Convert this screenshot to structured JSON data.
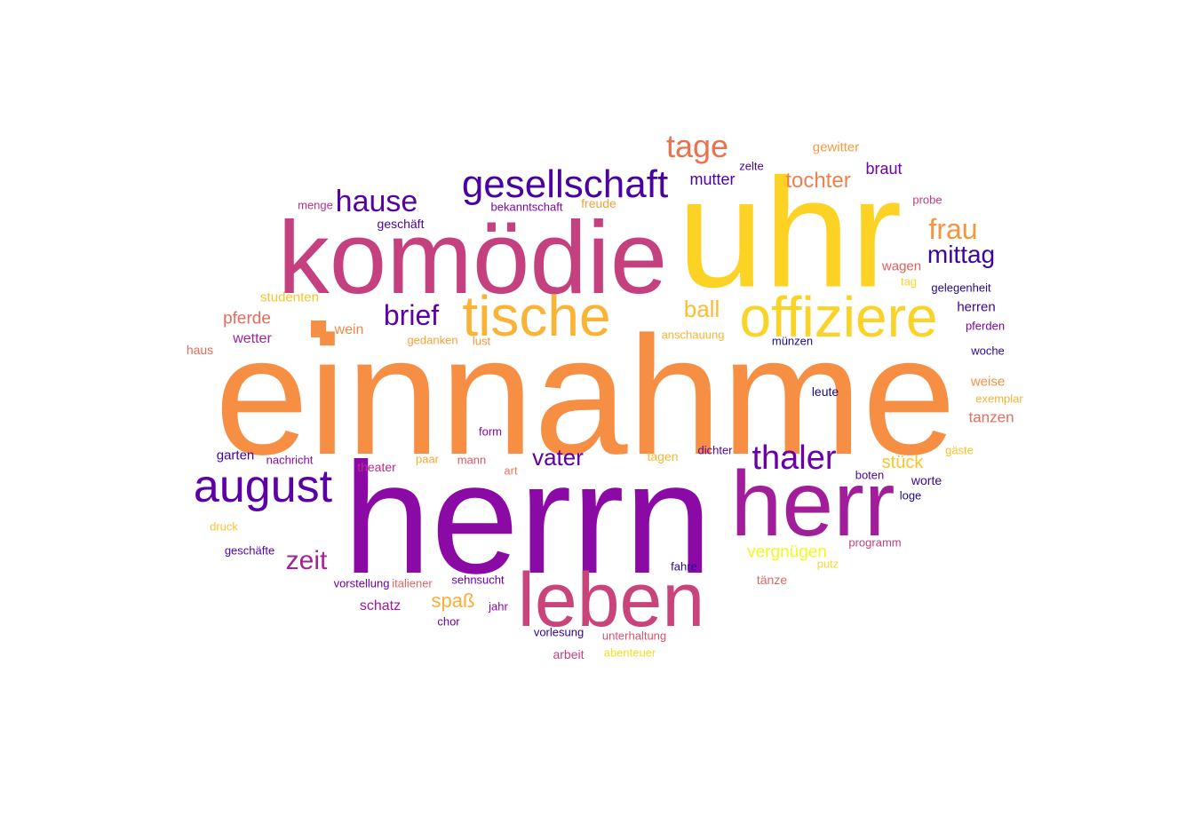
{
  "words": [
    {
      "text": "einnahme",
      "color": "#f68f44"
    },
    {
      "text": "herrn",
      "color": "#8b0aa5"
    },
    {
      "text": "uhr",
      "color": "#fcd225"
    },
    {
      "text": "komödie",
      "color": "#c5407e"
    },
    {
      "text": "herr",
      "color": "#a21d9a"
    },
    {
      "text": "leben",
      "color": "#c8447b"
    },
    {
      "text": "offiziere",
      "color": "#fbd328"
    },
    {
      "text": "tische",
      "color": "#fab334"
    },
    {
      "text": "august",
      "color": "#5c01a6"
    },
    {
      "text": "gesellschaft",
      "color": "#4a02a0"
    },
    {
      "text": "thaler",
      "color": "#6a00a8"
    },
    {
      "text": "tage",
      "color": "#e8744f"
    },
    {
      "text": "hause",
      "color": "#5402a3"
    },
    {
      "text": "brief",
      "color": "#5c01a6"
    },
    {
      "text": "zeit",
      "color": "#a72197"
    },
    {
      "text": "vater",
      "color": "#6100a7"
    },
    {
      "text": "frau",
      "color": "#f49640"
    },
    {
      "text": "mittag",
      "color": "#3e049c"
    },
    {
      "text": "ball",
      "color": "#fbbc33"
    },
    {
      "text": "tochter",
      "color": "#f0804b"
    },
    {
      "text": "spaß",
      "color": "#fbad35"
    },
    {
      "text": "stück",
      "color": "#fac42a"
    },
    {
      "text": "vergnügen",
      "color": "#f0f921"
    },
    {
      "text": "pferde",
      "color": "#e56b5d"
    },
    {
      "text": "mutter",
      "color": "#4c02a1"
    },
    {
      "text": "braut",
      "color": "#7201a8"
    },
    {
      "text": "wein",
      "color": "#f48849"
    },
    {
      "text": "wetter",
      "color": "#a62098"
    },
    {
      "text": "tanzen",
      "color": "#e66c5c"
    },
    {
      "text": "schatz",
      "color": "#9c179e"
    },
    {
      "text": "gewitter",
      "color": "#f39c41"
    },
    {
      "text": "studenten",
      "color": "#fac22b"
    },
    {
      "text": "wagen",
      "color": "#e0605e"
    },
    {
      "text": "weise",
      "color": "#f68f44"
    },
    {
      "text": "herren",
      "color": "#3a049a"
    },
    {
      "text": "garten",
      "color": "#42039d"
    },
    {
      "text": "leute",
      "color": "#1a068b"
    },
    {
      "text": "tagen",
      "color": "#fbb631"
    },
    {
      "text": "tänze",
      "color": "#e16462"
    },
    {
      "text": "geschäft",
      "color": "#4902a0"
    },
    {
      "text": "freude",
      "color": "#f7a03c"
    },
    {
      "text": "worte",
      "color": "#3b049a"
    },
    {
      "text": "theater",
      "color": "#b52f8c"
    },
    {
      "text": "exemplar",
      "color": "#fbb131"
    },
    {
      "text": "gäste",
      "color": "#fcc029"
    },
    {
      "text": "haus",
      "color": "#e56a5d"
    },
    {
      "text": "bekanntschaft",
      "color": "#7e03a8"
    },
    {
      "text": "münzen",
      "color": "#1e0690"
    },
    {
      "text": "woche",
      "color": "#2d0594"
    },
    {
      "text": "programm",
      "color": "#c2417f"
    },
    {
      "text": "vorlesung",
      "color": "#2c0594"
    },
    {
      "text": "unterhaltung",
      "color": "#d5536f"
    },
    {
      "text": "sehnsucht",
      "color": "#6a00a8"
    },
    {
      "text": "vorstellung",
      "color": "#6a00a8"
    },
    {
      "text": "geschäfte",
      "color": "#5102a3"
    },
    {
      "text": "nachricht",
      "color": "#8a0aa6"
    },
    {
      "text": "gelegenheit",
      "color": "#280592"
    },
    {
      "text": "boten",
      "color": "#5102a3"
    },
    {
      "text": "loge",
      "color": "#23068f"
    },
    {
      "text": "fahre",
      "color": "#2b0594"
    },
    {
      "text": "mann",
      "color": "#d8576b"
    },
    {
      "text": "paar",
      "color": "#f9a738"
    },
    {
      "text": "italiener",
      "color": "#e16462"
    },
    {
      "text": "anschauung",
      "color": "#fab232"
    },
    {
      "text": "gedanken",
      "color": "#f9a339"
    },
    {
      "text": "arbeit",
      "color": "#c33d80"
    },
    {
      "text": "abenteuer",
      "color": "#f0e121"
    },
    {
      "text": "form",
      "color": "#8606a6"
    },
    {
      "text": "menge",
      "color": "#bc3488"
    },
    {
      "text": "zelte",
      "color": "#4c02a1"
    },
    {
      "text": "probe",
      "color": "#c13b82"
    },
    {
      "text": "tag",
      "color": "#fbd52a"
    },
    {
      "text": "pferden",
      "color": "#7d03a8"
    },
    {
      "text": "lust",
      "color": "#f89540"
    },
    {
      "text": "dichter",
      "color": "#5402a3"
    },
    {
      "text": "art",
      "color": "#ed7953"
    },
    {
      "text": "druck",
      "color": "#fcc42c"
    },
    {
      "text": "putz",
      "color": "#fad82c"
    },
    {
      "text": "jahr",
      "color": "#8b0aa5"
    },
    {
      "text": "chor",
      "color": "#6a00a8"
    }
  ]
}
